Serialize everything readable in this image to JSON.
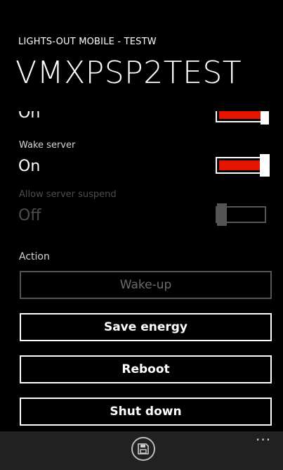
{
  "header": {
    "app_label": "LIGHTS-OUT MOBILE - TESTW",
    "title": "VMXPSP2TEST"
  },
  "settings": {
    "partial_value": "On",
    "wake": {
      "label": "Wake server",
      "value": "On",
      "checked": true,
      "enabled": true
    },
    "suspend": {
      "label": "Allow server suspend",
      "value": "Off",
      "checked": false,
      "enabled": false
    }
  },
  "action": {
    "label": "Action",
    "buttons": {
      "wake_up": "Wake-up",
      "save_energy": "Save energy",
      "reboot": "Reboot",
      "shut_down": "Shut down"
    }
  },
  "app_bar": {
    "save_icon": "floppy-disk-icon",
    "more": "..."
  },
  "colors": {
    "accent": "#e51400",
    "background": "#000000",
    "app_bar": "#212121"
  }
}
